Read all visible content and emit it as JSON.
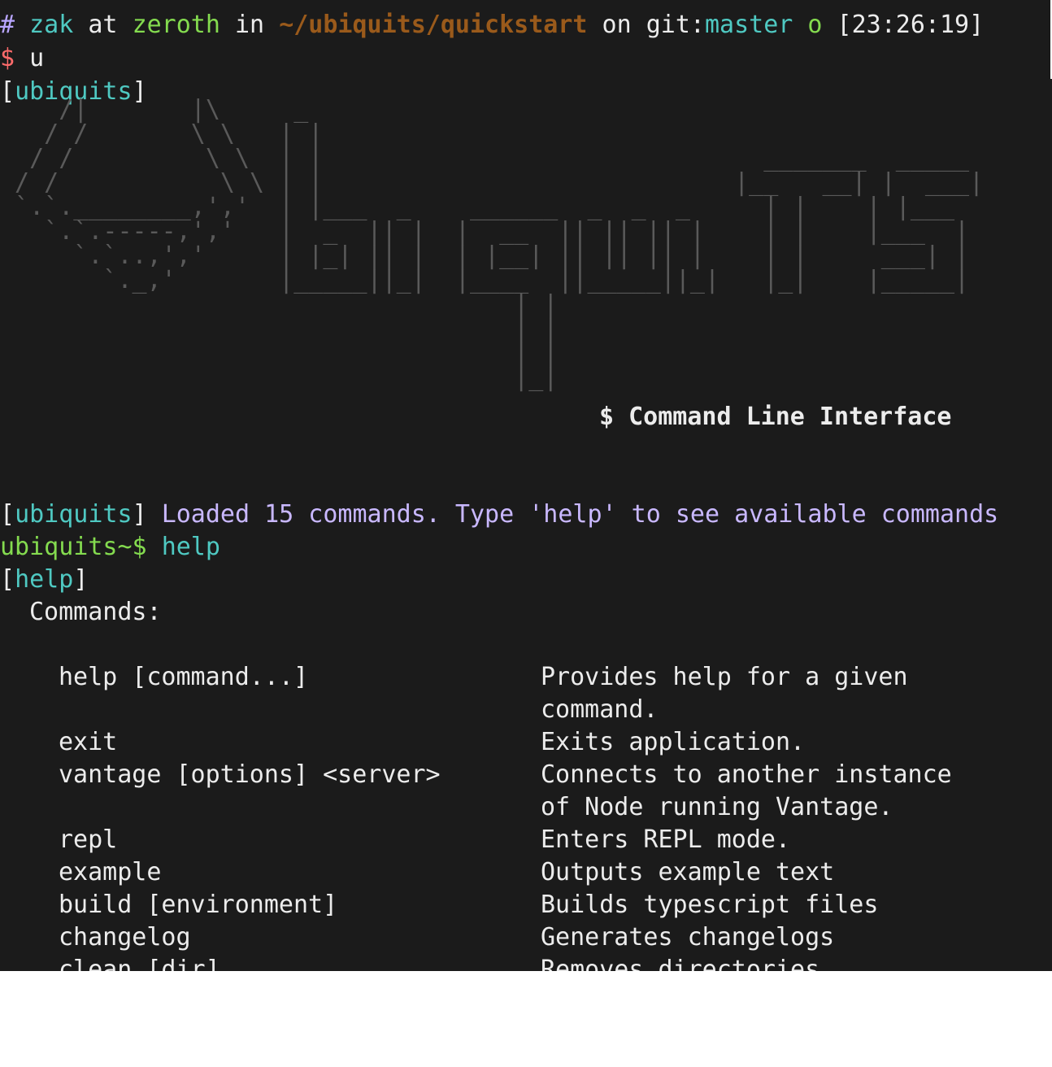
{
  "prompt": {
    "hash": "#",
    "user": "zak",
    "at": "at",
    "host": "zeroth",
    "in": "in",
    "path": "~/ubiquits/quickstart",
    "on": "on",
    "git_label": "git:",
    "branch": "master",
    "status": "o",
    "time": "[23:26:19]",
    "dollar": "$",
    "command": "u"
  },
  "tag_open": "[",
  "tag_close": "]",
  "app_tag": "ubiquits",
  "ascii_art": "    /|       |\\     _\n   / /       \\ \\   | |\n  / /         \\ \\  | |                              _______  _____\n / /           \\ \\ | |                            |__   __| |  ___|\n `.`.________,','  | |___  _    ______  _  _  _     | |    | |___\n   `.`.-----,','   |  _  || |  |  __  || || || |    | |    |___  |\n     `.`..,','     | |_| || |  | |__| || || || |    | |     ___| |\n       `._,'       |_____||_|  |____  ||_____||_|   |_|    |_____|\n                                   | |\n                                   | |\n                                   | |\n                                   |_|",
  "banner_title": "$ Command Line Interface",
  "loaded_message": "Loaded 15 commands. Type 'help' to see available commands",
  "shell_prompt": "ubiquits~$",
  "shell_command": "help",
  "help_tag": "help",
  "commands_heading": "Commands:",
  "commands": [
    {
      "name": "help [command...]",
      "desc": "Provides help for a given",
      "desc2": "command."
    },
    {
      "name": "exit",
      "desc": "Exits application."
    },
    {
      "name": "vantage [options] <server>",
      "desc": "Connects to another instance",
      "desc2": "of Node running Vantage."
    },
    {
      "name": "repl",
      "desc": "Enters REPL mode."
    },
    {
      "name": "example",
      "desc": "Outputs example text"
    },
    {
      "name": "build [environment]",
      "desc": "Builds typescript files"
    },
    {
      "name": "changelog",
      "desc": "Generates changelogs"
    },
    {
      "name": "clean [dir]",
      "desc": "Removes directories"
    }
  ],
  "colors": {
    "background": "#1b1b1b",
    "teal": "#4fc9c2",
    "green": "#84db4f",
    "path_brown": "#9a5a1b",
    "prompt_red": "#ff6b6b",
    "message_lavender": "#c9b8ff"
  }
}
